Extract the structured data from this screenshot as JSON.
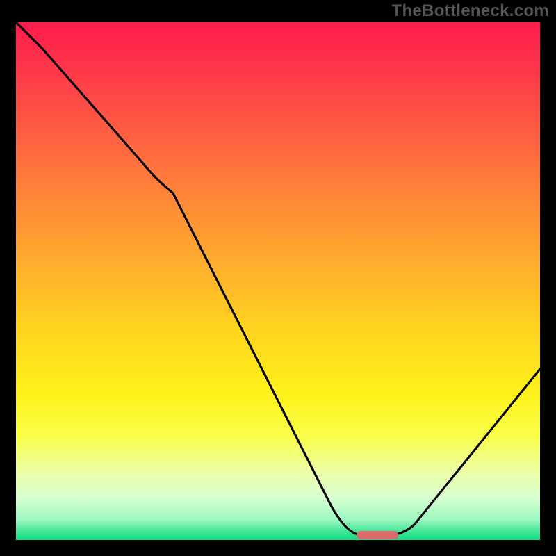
{
  "watermark": "TheBottleneck.com",
  "chart_data": {
    "type": "line",
    "title": "",
    "xlabel": "",
    "ylabel": "",
    "xlim": [
      0,
      100
    ],
    "ylim": [
      0,
      100
    ],
    "grid": false,
    "legend": false,
    "series": [
      {
        "name": "curve",
        "x": [
          0,
          5,
          24,
          30,
          60,
          66,
          71,
          76,
          100
        ],
        "values": [
          100,
          95,
          73,
          67,
          7,
          1,
          1,
          3,
          33
        ]
      }
    ],
    "marker": {
      "x0": 65,
      "x1": 73,
      "y": 0.9
    },
    "gradient_stops": [
      {
        "pct": 0,
        "color": "#ff1a4d"
      },
      {
        "pct": 25,
        "color": "#ff6a3f"
      },
      {
        "pct": 50,
        "color": "#ffb22c"
      },
      {
        "pct": 72,
        "color": "#fff21a"
      },
      {
        "pct": 92,
        "color": "#d6ffd0"
      },
      {
        "pct": 100,
        "color": "#17d884"
      }
    ]
  }
}
